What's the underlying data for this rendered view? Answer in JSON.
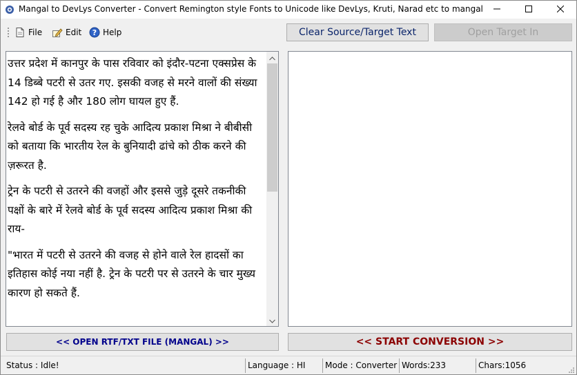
{
  "window": {
    "title": "Mangal to DevLys Converter - Convert Remington style Fonts to Unicode like DevLys, Kruti, Narad etc to mangal",
    "controls": {
      "minimize_icon": "minimize-icon",
      "maximize_icon": "maximize-icon",
      "close_icon": "close-icon"
    }
  },
  "menu": {
    "items": [
      {
        "label": "File",
        "icon": "file-icon"
      },
      {
        "label": "Edit",
        "icon": "edit-icon"
      },
      {
        "label": "Help",
        "icon": "help-icon"
      }
    ]
  },
  "toolbar": {
    "clear_label": "Clear Source/Target Text",
    "open_target_label": "Open Target In"
  },
  "source": {
    "paragraphs": [
      "उत्तर प्रदेश में कानपुर के पास रविवार को इंदौर-पटना एक्सप्रेस के 14 डिब्बे पटरी से उतर गए. इसकी वजह से मरने वालों की संख्या 142 हो गई है और 180 लोग घायल हुए हैं.",
      "रेलवे बोर्ड के पूर्व सदस्य रह चुके आदित्य प्रकाश मिश्रा ने बीबीसी को बताया कि भारतीय रेल के बुनियादी ढांचे को ठीक करने की ज़रूरत है.",
      "ट्रेन के पटरी से उतरने की वजहों और इससे जुड़े दूसरे तकनीकी पक्षों के बारे में रेलवे बोर्ड के पूर्व सदस्य आदित्य प्रकाश मिश्रा की राय-",
      "\"भारत में पटरी से उतरने की वजह से होने वाले रेल हादसों का इतिहास कोई नया नहीं है. ट्रेन के पटरी पर से उतरने के चार मुख्य कारण हो सकते हैं."
    ]
  },
  "target": {
    "text": ""
  },
  "actions": {
    "open_file_label": "<< OPEN RTF/TXT FILE (MANGAL) >>",
    "start_label": "<< START CONVERSION >>"
  },
  "status": {
    "status": "Status :   Idle!",
    "language": "Language : HI",
    "mode": "Mode : Converter",
    "words": "Words:233",
    "chars": "Chars:1056"
  },
  "colors": {
    "clear_text": "#0a246a",
    "open_file_text": "#00008b",
    "start_text": "#8b0000",
    "disabled_text": "#a0a0a0"
  }
}
